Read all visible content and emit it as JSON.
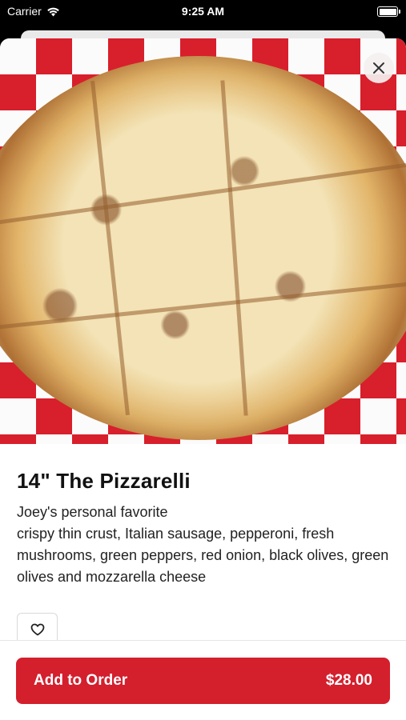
{
  "status_bar": {
    "carrier": "Carrier",
    "time": "9:25 AM",
    "icons": [
      "wifi-icon",
      "battery-icon"
    ]
  },
  "item": {
    "title": "14\" The Pizzarelli",
    "description_lines": [
      "Joey's personal favorite",
      "crispy thin crust, Italian sausage, pepperoni, fresh mushrooms, green peppers, red onion, black olives, green olives and mozzarella cheese"
    ],
    "image": "pizza-photo"
  },
  "actions": {
    "close_icon": "close-icon",
    "favorite_icon": "heart-icon",
    "add_label": "Add to Order",
    "price": "$28.00"
  },
  "colors": {
    "accent": "#d41f2d",
    "background": "#ffffff",
    "status_bar": "#000000"
  }
}
